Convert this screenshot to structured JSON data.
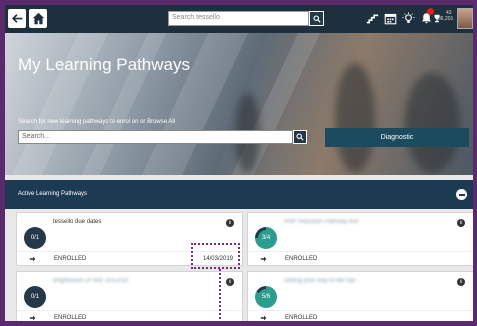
{
  "nav": {
    "search_placeholder": "Search tessello",
    "points_top": "43",
    "points_bottom": "86,201"
  },
  "hero": {
    "title": "My Learning Pathways",
    "subtitle": "Search for new learning pathways to enrol on or Browse All",
    "search_placeholder": "Search...",
    "diagnostic_label": "Diagnostic"
  },
  "active": {
    "label": "Active Learning Pathways"
  },
  "cards": [
    {
      "progress": "0/1",
      "title": "tessello due dates",
      "status": "ENROLLED",
      "date": "14/03/2019"
    },
    {
      "progress": "3/4",
      "title": "RHP Induction Pathway test",
      "status": "ENROLLED",
      "date": ""
    },
    {
      "progress": "0/1",
      "title": "Brightwave LP test 10/12/18",
      "status": "ENROLLED",
      "date": ""
    },
    {
      "progress": "5/6",
      "title": "Selling your way to the top!",
      "status": "ENROLLED",
      "date": ""
    }
  ],
  "colors": {
    "nav_bg": "#1e2f3e",
    "accent": "#1c4a5e",
    "teal": "#2a9d8f",
    "highlight": "#7b2a8a"
  }
}
